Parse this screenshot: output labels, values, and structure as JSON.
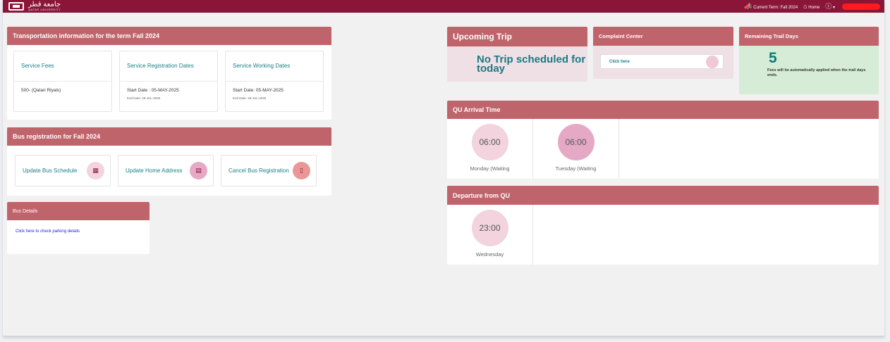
{
  "topbar": {
    "logo_arabic": "جامعة قطر",
    "logo_english": "QATAR UNIVERSITY",
    "term_label": "Current Term: Fall 2024",
    "home_label": "Home",
    "help_icon": "help-icon"
  },
  "transport": {
    "title": "Transportation information for the term Fall 2024",
    "cards": [
      {
        "title": "Service Fees",
        "value": "500- (Qatari Riyals)",
        "sub": ""
      },
      {
        "title": "Service Registration Dates",
        "value": "Start Date : 05-MAY-2025",
        "sub": "End Date: 28-JUL-2025"
      },
      {
        "title": "Service Working Dates",
        "value": "Start Date: 05-MAY-2025",
        "sub": "End Date: 28-JUL-2025"
      }
    ]
  },
  "bus_registration": {
    "title": "Bus registration for Fall 2024",
    "actions": [
      {
        "label": "Update Bus Schedule",
        "icon": "calendar-icon",
        "color": "#f2d3de"
      },
      {
        "label": "Update Home Address",
        "icon": "document-icon",
        "color": "#e5a9c6"
      },
      {
        "label": "Cancel Bus Registration",
        "icon": "trash-icon",
        "color": "#ea9897"
      }
    ]
  },
  "bus_details": {
    "title": "Bus Details",
    "link": "Click here to check parking details"
  },
  "upcoming": {
    "title": "Upcoming Trip",
    "message": "No Trip scheduled for today"
  },
  "complaint": {
    "title": "Complaint Center",
    "link": "Click here"
  },
  "trail": {
    "title": "Remaining Trail Days",
    "days": "5",
    "note": "Fees will be automatically applied when the trail days ends."
  },
  "arrival": {
    "title": "QU Arrival Time",
    "times": [
      {
        "time": "06:00",
        "day": "Monday (Waiting",
        "color": "#f2d3de"
      },
      {
        "time": "06:00",
        "day": "Tuesday (Waiting",
        "color": "#e5a9c6"
      }
    ]
  },
  "departure": {
    "title": "Departure from QU",
    "times": [
      {
        "time": "23:00",
        "day": "Wednesday",
        "color": "#f2d3de"
      }
    ]
  },
  "colors": {
    "brand": "#8a1538",
    "header": "#c0646b",
    "accent_text": "#1b7f86",
    "trail_bg": "#d6ecd6",
    "upcoming_bg": "#efe0e6"
  }
}
